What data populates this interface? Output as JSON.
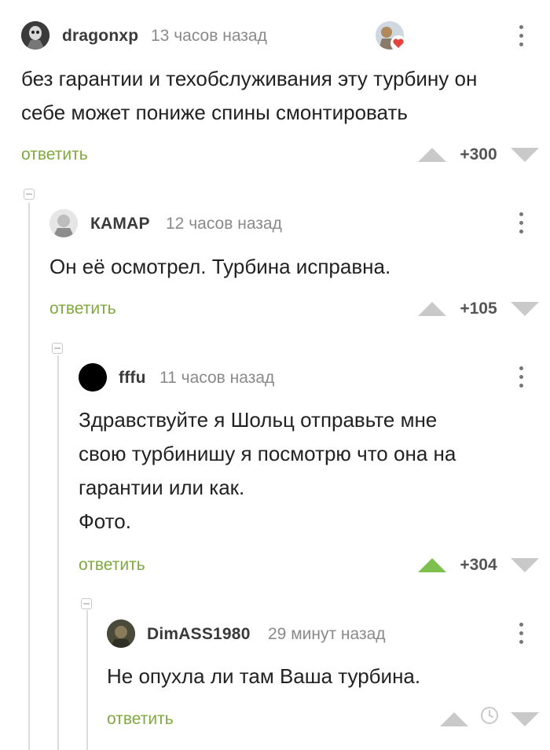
{
  "comments": [
    {
      "author": "dragonxp",
      "time": "13 часов назад",
      "text": "без гарантии и техобслуживания эту турбину он\nсебе может пониже спины смонтировать",
      "reply_label": "ответить",
      "score": "+300",
      "upvoted": false
    },
    {
      "author": "КАМАР",
      "time": "12 часов назад",
      "text": "Он её осмотрел. Турбина исправна.",
      "reply_label": "ответить",
      "score": "+105",
      "upvoted": false
    },
    {
      "author": "fffu",
      "time": "11 часов назад",
      "text": "Здравствуйте я Шольц отправьте мне\nсвою турбинишу я посмотрю что она на\nгарантии или как.\nФото.",
      "reply_label": "ответить",
      "score": "+304",
      "upvoted": true
    },
    {
      "author": "DimASS1980",
      "time": "29 минут назад",
      "text": "Не опухла ли там Ваша турбина.",
      "reply_label": "ответить",
      "score": "",
      "upvoted": false
    }
  ],
  "colors": {
    "reply_green": "#7fa93e",
    "upvote_active": "#7fbf4d",
    "vote_inactive": "#c9c9c9"
  },
  "icons": [
    "avatar-image",
    "heart-badge-icon",
    "more-options-icon",
    "collapse-icon",
    "upvote-icon",
    "downvote-icon",
    "clock-icon"
  ]
}
